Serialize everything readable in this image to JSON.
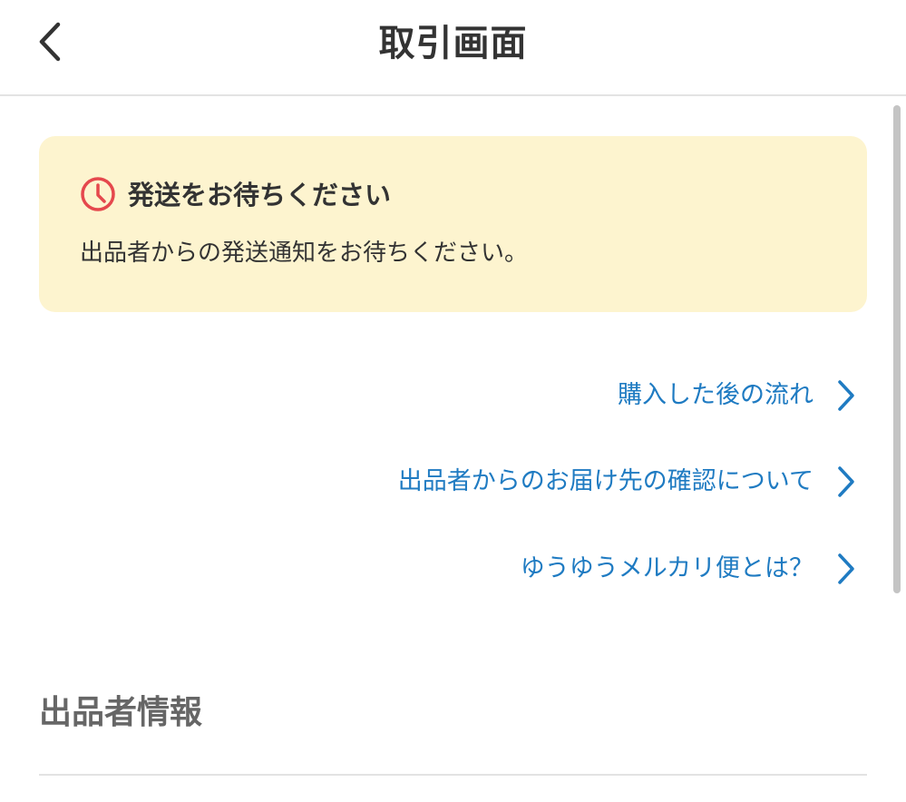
{
  "header": {
    "title": "取引画面",
    "back_icon": "chevron-left-icon"
  },
  "notice": {
    "icon": "clock-icon",
    "icon_color": "#e5484d",
    "title": "発送をお待ちください",
    "body": "出品者からの発送通知をお待ちください。",
    "background": "#fdf4cf"
  },
  "links": [
    {
      "label": "購入した後の流れ",
      "icon": "chevron-right-icon"
    },
    {
      "label": "出品者からのお届け先の確認について",
      "icon": "chevron-right-icon"
    },
    {
      "label": "ゆうゆうメルカリ便とは？",
      "icon": "chevron-right-icon"
    }
  ],
  "link_color": "#1f7bc2",
  "seller_section": {
    "title": "出品者情報"
  }
}
